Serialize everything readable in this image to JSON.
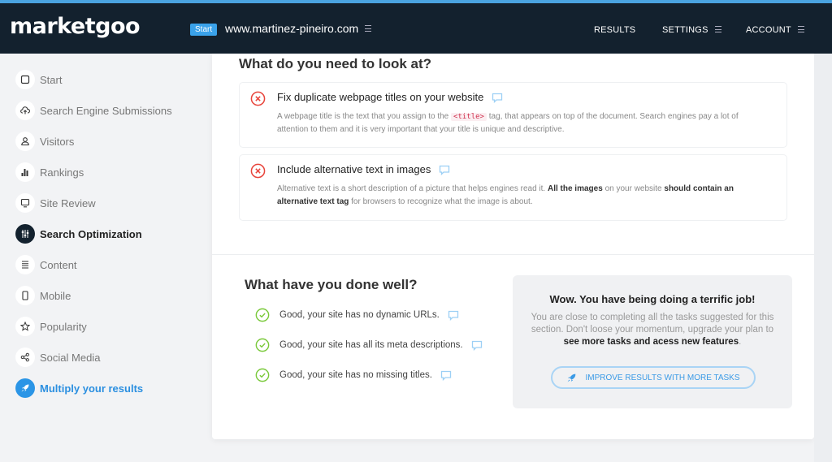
{
  "header": {
    "logo": "marketgoo",
    "start_badge": "Start",
    "domain": "www.martinez-pineiro.com",
    "nav": [
      {
        "label": "RESULTS",
        "has_menu": false
      },
      {
        "label": "SETTINGS",
        "has_menu": true
      },
      {
        "label": "ACCOUNT",
        "has_menu": true
      }
    ]
  },
  "sidebar": {
    "items": [
      {
        "label": "Start",
        "icon": "square-icon",
        "state": "normal"
      },
      {
        "label": "Search Engine Submissions",
        "icon": "cloud-upload-icon",
        "state": "normal"
      },
      {
        "label": "Visitors",
        "icon": "user-icon",
        "state": "normal"
      },
      {
        "label": "Rankings",
        "icon": "bar-chart-icon",
        "state": "normal"
      },
      {
        "label": "Site Review",
        "icon": "monitor-icon",
        "state": "normal"
      },
      {
        "label": "Search Optimization",
        "icon": "sliders-icon",
        "state": "active"
      },
      {
        "label": "Content",
        "icon": "lines-icon",
        "state": "normal"
      },
      {
        "label": "Mobile",
        "icon": "mobile-icon",
        "state": "normal"
      },
      {
        "label": "Popularity",
        "icon": "star-icon",
        "state": "normal"
      },
      {
        "label": "Social Media",
        "icon": "share-icon",
        "state": "normal"
      },
      {
        "label": "Multiply your results",
        "icon": "rocket-icon",
        "state": "promo"
      }
    ]
  },
  "main": {
    "look_at": {
      "title": "What do you need to look at?",
      "issues": [
        {
          "title": "Fix duplicate webpage titles on your website",
          "desc_before": "A webpage title is the text that you assign to the",
          "code": "<title>",
          "desc_after": "tag, that appears on top of the document. Search engines pay a lot of attention to them and it is very important that your title is unique and descriptive."
        },
        {
          "title": "Include alternative text in images",
          "desc_1": "Alternative text is a short description of a picture that helps engines read it.",
          "desc_bold_1": "All the images",
          "desc_2": "on your website",
          "desc_bold_2": "should contain an alternative text tag",
          "desc_3": "for browsers to recognize what the image is about."
        }
      ]
    },
    "done_well": {
      "title": "What have you done well?",
      "items": [
        "Good, your site has no dynamic URLs.",
        "Good, your site has all its meta descriptions.",
        "Good, your site has no missing titles."
      ]
    },
    "promo": {
      "title": "Wow. You have being doing a terrific job!",
      "text": "You are close to completing all the tasks suggested for this section. Don't loose your momentum, upgrade your plan to",
      "text_bold": "see more tasks and acess new features",
      "text_end": ".",
      "button": "IMPROVE RESULTS WITH MORE TASKS"
    }
  },
  "colors": {
    "header_bg": "#13212e",
    "accent": "#3aa2ea",
    "error": "#e8453c",
    "success": "#7ac93b"
  }
}
